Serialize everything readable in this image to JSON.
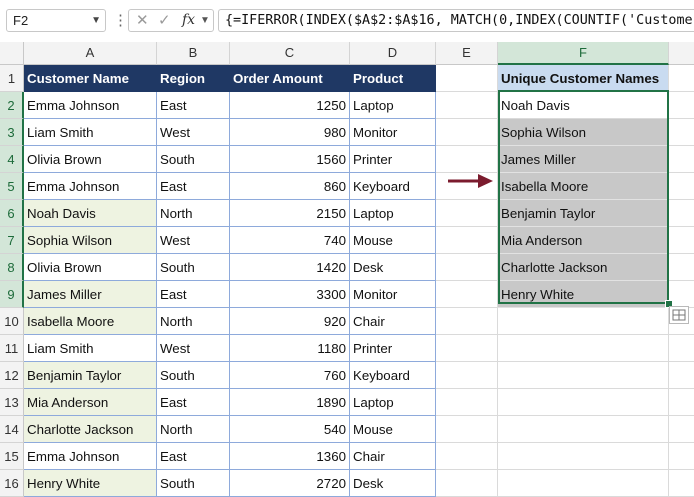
{
  "name_box": "F2",
  "formula": "{=IFERROR(INDEX($A$2:$A$16, MATCH(0,INDEX(COUNTIF('Customer",
  "icons": {
    "dropdown": "chevron-down-icon",
    "more": "vertical-dots-icon",
    "cancel": "x-icon",
    "confirm": "check-icon",
    "fx": "function-icon",
    "arrow": "right-arrow-icon",
    "quick_analysis": "quick-analysis-icon"
  },
  "fx_label": "fx",
  "columns": [
    "A",
    "B",
    "C",
    "D",
    "E",
    "F"
  ],
  "rows": [
    "1",
    "2",
    "3",
    "4",
    "5",
    "6",
    "7",
    "8",
    "9",
    "10",
    "11",
    "12",
    "13",
    "14",
    "15",
    "16"
  ],
  "headers": {
    "name": "Customer Name",
    "region": "Region",
    "amount": "Order Amount",
    "product": "Product",
    "unique": "Unique Customer Names"
  },
  "orders": [
    {
      "name": "Emma Johnson",
      "region": "East",
      "amount": "1250",
      "product": "Laptop"
    },
    {
      "name": "Liam Smith",
      "region": "West",
      "amount": "980",
      "product": "Monitor"
    },
    {
      "name": "Olivia Brown",
      "region": "South",
      "amount": "1560",
      "product": "Printer"
    },
    {
      "name": "Emma Johnson",
      "region": "East",
      "amount": "860",
      "product": "Keyboard"
    },
    {
      "name": "Noah Davis",
      "region": "North",
      "amount": "2150",
      "product": "Laptop"
    },
    {
      "name": "Sophia Wilson",
      "region": "West",
      "amount": "740",
      "product": "Mouse"
    },
    {
      "name": "Olivia Brown",
      "region": "South",
      "amount": "1420",
      "product": "Desk"
    },
    {
      "name": "James Miller",
      "region": "East",
      "amount": "3300",
      "product": "Monitor"
    },
    {
      "name": "Isabella Moore",
      "region": "North",
      "amount": "920",
      "product": "Chair"
    },
    {
      "name": "Liam Smith",
      "region": "West",
      "amount": "1180",
      "product": "Printer"
    },
    {
      "name": "Benjamin Taylor",
      "region": "South",
      "amount": "760",
      "product": "Keyboard"
    },
    {
      "name": "Mia Anderson",
      "region": "East",
      "amount": "1890",
      "product": "Laptop"
    },
    {
      "name": "Charlotte Jackson",
      "region": "North",
      "amount": "540",
      "product": "Mouse"
    },
    {
      "name": "Emma Johnson",
      "region": "East",
      "amount": "1360",
      "product": "Chair"
    },
    {
      "name": "Henry White",
      "region": "South",
      "amount": "2720",
      "product": "Desk"
    }
  ],
  "unique_names": [
    "Noah Davis",
    "Sophia Wilson",
    "James Miller",
    "Isabella Moore",
    "Benjamin Taylor",
    "Mia Anderson",
    "Charlotte Jackson",
    "Henry White"
  ],
  "colors": {
    "table_header": "#1f3864",
    "highlight": "#eef3e1",
    "unique_header": "#c9dbf0",
    "result_fill": "#c8c8c8",
    "selection": "#217346",
    "arrow": "#7b1b2e"
  }
}
